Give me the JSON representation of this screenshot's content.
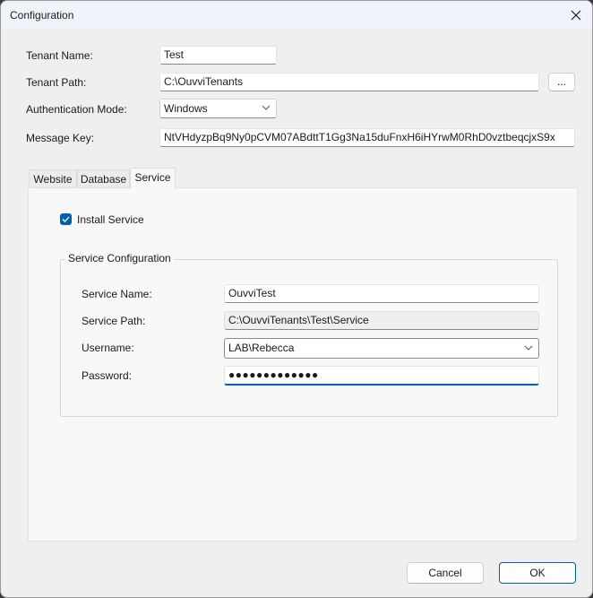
{
  "window": {
    "title": "Configuration",
    "close_icon": "close-icon"
  },
  "fields": {
    "tenant_name": {
      "label": "Tenant Name:",
      "value": "Test"
    },
    "tenant_path": {
      "label": "Tenant Path:",
      "value": "C:\\OuvviTenants",
      "browse_label": "..."
    },
    "auth_mode": {
      "label": "Authentication Mode:",
      "value": "Windows"
    },
    "message_key": {
      "label": "Message Key:",
      "value": "NtVHdyzpBq9Ny0pCVM07ABdttT1Gg3Na15duFnxH6iHYrwM0RhD0vztbeqcjxS9x"
    }
  },
  "tabs": [
    {
      "label": "Website",
      "active": false
    },
    {
      "label": "Database",
      "active": false
    },
    {
      "label": "Service",
      "active": true
    }
  ],
  "service_tab": {
    "install_service": {
      "label": "Install Service",
      "checked": true
    },
    "group_title": "Service Configuration",
    "service_name": {
      "label": "Service Name:",
      "value": "OuvviTest"
    },
    "service_path": {
      "label": "Service Path:",
      "value": "C:\\OuvviTenants\\Test\\Service"
    },
    "username": {
      "label": "Username:",
      "value": "LAB\\Rebecca"
    },
    "password": {
      "label": "Password:",
      "value": "●●●●●●●●●●●●●"
    }
  },
  "buttons": {
    "cancel": "Cancel",
    "ok": "OK"
  },
  "colors": {
    "accent": "#005fb8",
    "titlebar": "#f0f3f9",
    "dialog_bg": "#efefef"
  }
}
